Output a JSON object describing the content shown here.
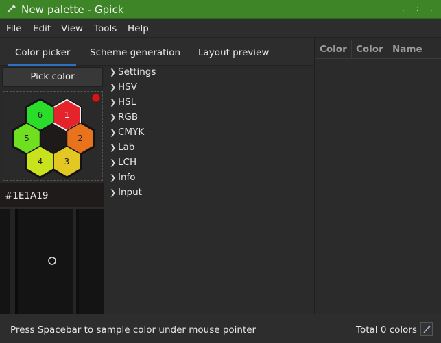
{
  "window": {
    "title": "New palette - Gpick",
    "controls": {
      "minimize": ".",
      "maximize": ":",
      "close": "."
    }
  },
  "menu": [
    "File",
    "Edit",
    "View",
    "Tools",
    "Help"
  ],
  "tabs": {
    "items": [
      "Color picker",
      "Scheme generation",
      "Layout preview"
    ],
    "active": 0
  },
  "picker": {
    "pick_button": "Pick color",
    "swatches": [
      {
        "label": "1",
        "color": "#e4232b"
      },
      {
        "label": "2",
        "color": "#e8731c"
      },
      {
        "label": "3",
        "color": "#e3c722"
      },
      {
        "label": "4",
        "color": "#c8e31e"
      },
      {
        "label": "5",
        "color": "#6fe01f"
      },
      {
        "label": "6",
        "color": "#2bdd2b"
      }
    ],
    "center_color": "#1e1a19",
    "indicator_color": "#e40f0f",
    "hex_value": "#1E1A19"
  },
  "settings_rows": [
    "Settings",
    "HSV",
    "HSL",
    "RGB",
    "CMYK",
    "Lab",
    "LCH",
    "Info",
    "Input"
  ],
  "palette": {
    "columns": [
      "Color",
      "Color",
      "Name"
    ]
  },
  "status": {
    "message": "Press Spacebar to sample color under mouse pointer",
    "total": "Total 0 colors"
  },
  "colors": {
    "titlebar": "#3d8526",
    "accent": "#2d6fc0"
  }
}
